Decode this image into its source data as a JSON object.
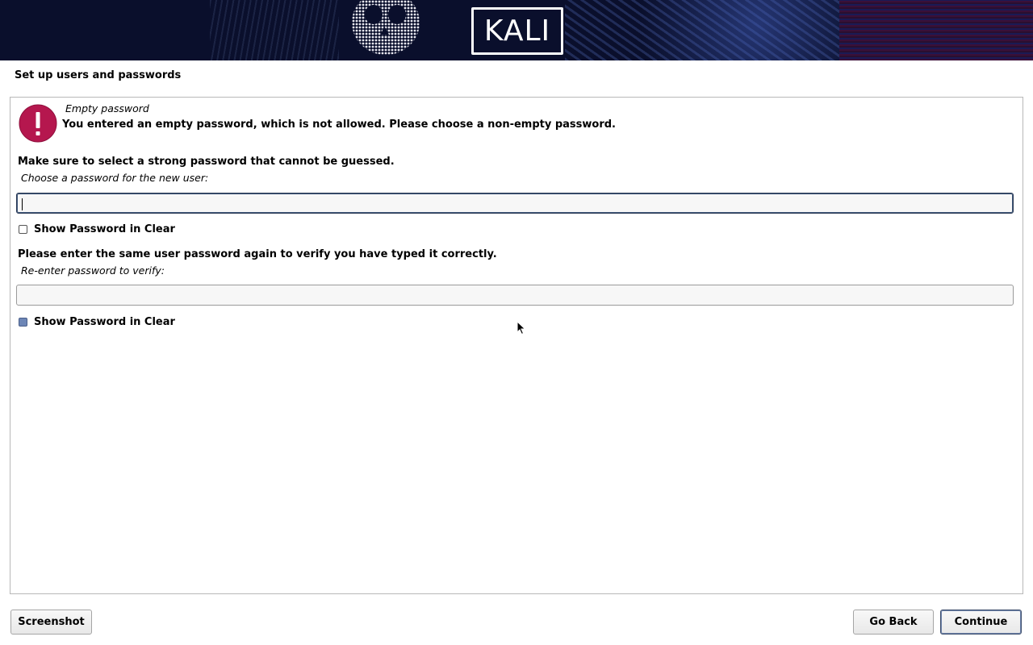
{
  "banner": {
    "logo_text": "KALI"
  },
  "page": {
    "title": "Set up users and passwords"
  },
  "alert": {
    "title": "Empty password",
    "message": "You entered an empty password, which is not allowed. Please choose a non-empty password.",
    "icon": "exclamation-icon",
    "icon_color": "#b5174e"
  },
  "password": {
    "hint": "Make sure to select a strong password that cannot be guessed.",
    "label": "Choose a password for the new user:",
    "value": "",
    "show_label": "Show Password in Clear"
  },
  "verify": {
    "hint": "Please enter the same user password again to verify you have typed it correctly.",
    "label": "Re-enter password to verify:",
    "value": "",
    "show_label": "Show Password in Clear"
  },
  "buttons": {
    "screenshot": "Screenshot",
    "go_back": "Go Back",
    "continue": "Continue"
  }
}
